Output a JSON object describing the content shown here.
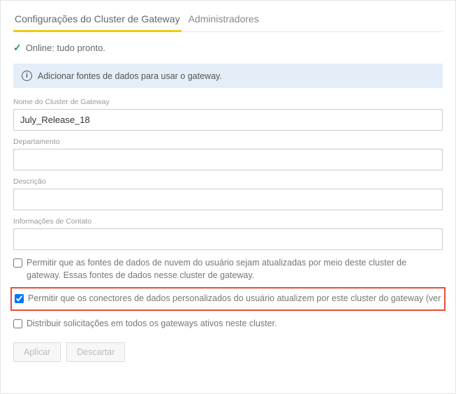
{
  "tabs": {
    "settings": "Configurações do Cluster de Gateway",
    "admins": "Administradores"
  },
  "status": {
    "text": "Online: tudo pronto."
  },
  "banner": {
    "text": "Adicionar fontes de dados para usar o gateway."
  },
  "fields": {
    "cluster_name_label": "Nome do Cluster de Gateway",
    "cluster_name_value": "July_Release_18",
    "department_label": "Departamento",
    "department_value": "",
    "description_label": "Descrição",
    "description_value": "",
    "contact_label": "Informações de Contato",
    "contact_value": ""
  },
  "checkboxes": {
    "cloud_sources": "Permitir que as fontes de dados de nuvem do usuário sejam atualizadas por meio deste cluster de gateway. Essas fontes de dados nesse cluster de gateway.",
    "custom_connectors": "Permitir que os conectores de dados personalizados do usuário atualizem por este cluster do gateway (versão pré",
    "distribute": "Distribuir solicitações em todos os gateways ativos neste cluster."
  },
  "buttons": {
    "apply": "Aplicar",
    "discard": "Descartar"
  }
}
